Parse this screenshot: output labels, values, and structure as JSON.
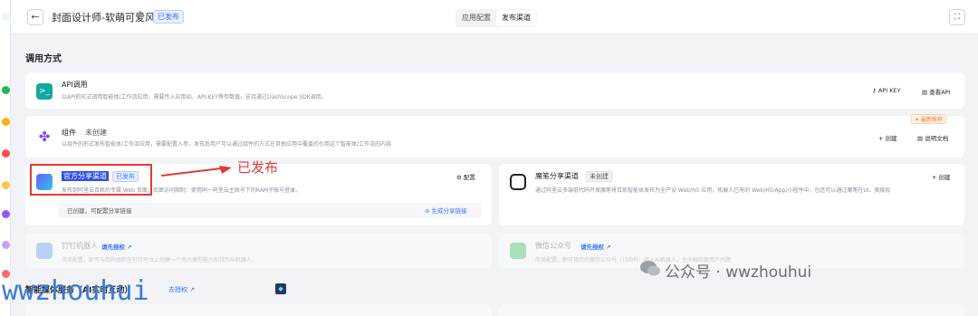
{
  "header": {
    "title": "封面设计师-软萌可爱风",
    "status_badge": "已发布",
    "tabs": [
      "应用配置",
      "发布渠道"
    ],
    "active_tab": "发布渠道"
  },
  "section_title": "调用方式",
  "api_card": {
    "title": "API调用",
    "desc": "以API的形式调用智能体/工作流应用，需要传入应用ID、API-KEY等参数值，支持通过DashScope SDK调用。",
    "action1": "API KEY",
    "action2": "查看API"
  },
  "component_card": {
    "title": "组件",
    "status": "未创建",
    "desc": "以组件的形式发布智能体/工作流应用，需要配置入参，发布后用户可以通过组件的方式在其他应用中覆盖的引用这个智能体/工作流的内容",
    "badge": "最新推荐",
    "action1": "创建",
    "action2": "说明文档"
  },
  "official_card": {
    "title": "官方分享渠道",
    "badge": "已发布",
    "desc": "发布到阿里云百炼的专属 Web 页面，页面访问限制：使用同一阿里云主账号下的RAM子账号登录。",
    "config": "配置",
    "footer_status": "已创建，可配置分享链接",
    "footer_link": "生成分享链接"
  },
  "annotation": {
    "label": "已发布"
  },
  "moben_card": {
    "title": "魔笔分享渠道",
    "badge": "未创建",
    "desc": "通过阿里云多端低代码开发魔笔将百炼智能体发布为全产设 Web/H5 应用，拓展入已有的 Web/H5/App/小程序中。也还可以通过魔笔在UI、奥版际",
    "action": "创建"
  },
  "dingtalk_card": {
    "title": "钉钉机器人",
    "auth": "请先授权",
    "desc": "简单配置，即可与您的组织在钉钉平台上创建一个有大模型能力加持的AI机器人。"
  },
  "wechat_card": {
    "title": "微信公众号",
    "auth": "请先授权",
    "desc": "简单配置，即可将您的微信公众号（订阅号）接入AI机器人，全天候回复用户问题"
  },
  "media_section": {
    "title": "智能媒体服务（AI实时互动）",
    "auth": "去授权"
  },
  "watermarks": {
    "left": "wwzhouhui",
    "right": "公众号 · wwzhouhui"
  },
  "colors": {
    "accent": "#3370ff",
    "annotation": "#e53935"
  }
}
